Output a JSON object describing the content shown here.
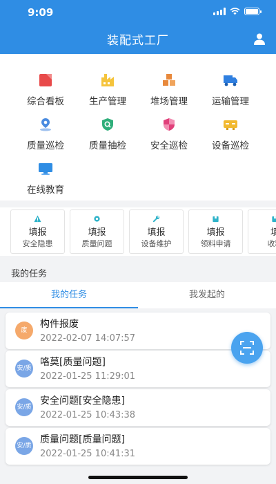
{
  "status_bar": {
    "time": "9:09"
  },
  "header": {
    "title": "装配式工厂",
    "user_icon": "user-icon"
  },
  "menu": {
    "items": [
      {
        "label": "综合看板",
        "icon": "dashboard-icon",
        "color": "#e84a4a"
      },
      {
        "label": "生产管理",
        "icon": "factory-icon",
        "color": "#f5c43c"
      },
      {
        "label": "堆场管理",
        "icon": "boxes-icon",
        "color": "#e8893c"
      },
      {
        "label": "运输管理",
        "icon": "truck-icon",
        "color": "#2f7fe0"
      },
      {
        "label": "质量巡检",
        "icon": "location-pin-icon",
        "color": "#4a8be0"
      },
      {
        "label": "质量抽检",
        "icon": "shield-search-icon",
        "color": "#2fae7a"
      },
      {
        "label": "安全巡检",
        "icon": "shield-check-icon",
        "color": "#e0407a"
      },
      {
        "label": "设备巡检",
        "icon": "device-icon",
        "color": "#f2b92f"
      },
      {
        "label": "在线教育",
        "icon": "monitor-icon",
        "color": "#2f8de4"
      }
    ]
  },
  "quick_actions": [
    {
      "line1": "填报",
      "line2": "安全隐患",
      "icon": "warning-icon",
      "color": "#2fb3c9"
    },
    {
      "line1": "填报",
      "line2": "质量问题",
      "icon": "gear-icon",
      "color": "#2fb3c9"
    },
    {
      "line1": "填报",
      "line2": "设备维护",
      "icon": "wrench-icon",
      "color": "#2fb3c9"
    },
    {
      "line1": "填报",
      "line2": "领料申请",
      "icon": "box-icon",
      "color": "#2fb3c9"
    },
    {
      "line1": "填",
      "line2": "收料",
      "icon": "box-icon",
      "color": "#2fb3c9"
    }
  ],
  "tasks_section": {
    "title": "我的任务",
    "tabs": [
      {
        "label": "我的任务",
        "active": true
      },
      {
        "label": "我发起的",
        "active": false
      }
    ]
  },
  "tasks": [
    {
      "badge": "废",
      "badge_color": "#f5a96b",
      "title": "构件报废",
      "time": "2022-02-07 14:07:57"
    },
    {
      "badge": "安/质",
      "badge_color": "#7aa6e6",
      "title": "咯莫[质量问题]",
      "time": "2022-01-25 11:29:01"
    },
    {
      "badge": "安/质",
      "badge_color": "#7aa6e6",
      "title": "安全问题[安全隐患]",
      "time": "2022-01-25 10:43:38"
    },
    {
      "badge": "安/质",
      "badge_color": "#7aa6e6",
      "title": "质量问题[质量问题]",
      "time": "2022-01-25 10:41:31"
    }
  ],
  "fab": {
    "icon": "scan-icon"
  },
  "colors": {
    "primary": "#2f8de4",
    "background": "#f2f3f5"
  }
}
